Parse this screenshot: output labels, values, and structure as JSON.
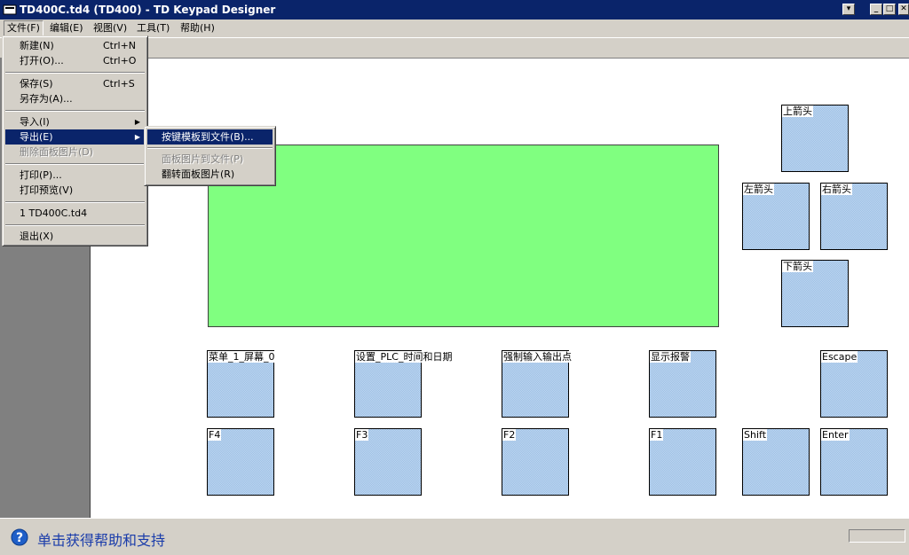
{
  "window": {
    "title": "TD400C.td4 (TD400) - TD Keypad Designer",
    "btn_extra": "▾",
    "btn_minimize": "_",
    "btn_maximize": "□",
    "btn_close": "✕"
  },
  "menubar": {
    "file": "文件(F)",
    "edit": "编辑(E)",
    "view": "视图(V)",
    "tools": "工具(T)",
    "help": "帮助(H)"
  },
  "file_menu": {
    "new": {
      "label": "新建(N)",
      "shortcut": "Ctrl+N"
    },
    "open": {
      "label": "打开(O)...",
      "shortcut": "Ctrl+O"
    },
    "save": {
      "label": "保存(S)",
      "shortcut": "Ctrl+S"
    },
    "save_as": {
      "label": "另存为(A)..."
    },
    "import": {
      "label": "导入(I)"
    },
    "export": {
      "label": "导出(E)"
    },
    "delete_panel_image": {
      "label": "删除面板图片(D)"
    },
    "print": {
      "label": "打印(P)..."
    },
    "print_preview": {
      "label": "打印预览(V)"
    },
    "recent1": {
      "label": "1 TD400C.td4"
    },
    "exit": {
      "label": "退出(X)"
    }
  },
  "export_submenu": {
    "keypad_template": "按键模板到文件(B)...",
    "panel_image_to_file": "面板图片到文件(P)",
    "flip_panel_image": "翻转面板图片(R)"
  },
  "keys": {
    "up": "上箭头",
    "left": "左箭头",
    "right": "右箭头",
    "down": "下箭头",
    "menu_screen": "菜单_1_屏幕_0",
    "set_plc_time": "设置_PLC_时间和日期",
    "force_io": "强制输入输出点",
    "show_alarms": "显示报警",
    "escape": "Escape",
    "f4": "F4",
    "f3": "F3",
    "f2": "F2",
    "f1": "F1",
    "shift": "Shift",
    "enter": "Enter"
  },
  "statusbar": {
    "help_text": "单击获得帮助和支持",
    "help_icon": "question-circle-icon"
  },
  "colors": {
    "titlebar": "#0a246a",
    "display": "#80ff80",
    "key": "#9cc0e6"
  }
}
